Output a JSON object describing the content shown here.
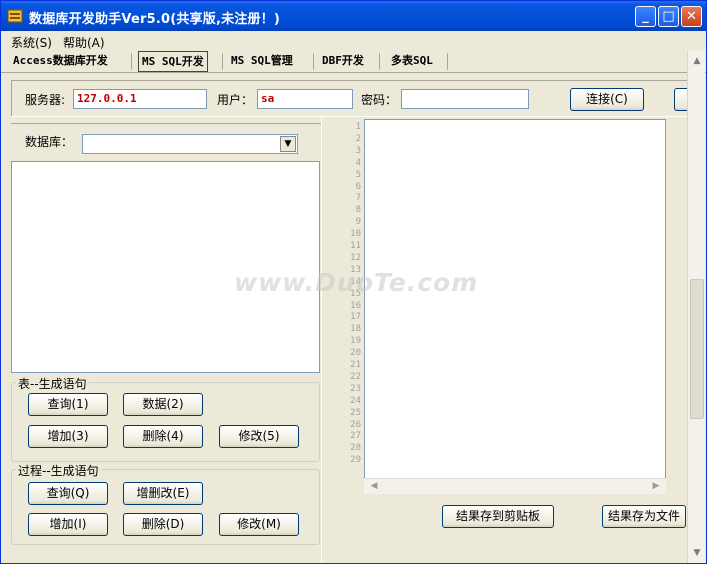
{
  "window": {
    "title": "数据库开发助手Ver5.0(共享版,未注册！)",
    "controls": {
      "minimize": "_",
      "maximize": "□",
      "close": "✕"
    }
  },
  "menu": [
    {
      "label": "系统(S)"
    },
    {
      "label": "帮助(A)"
    }
  ],
  "tabs": [
    {
      "label": "Access数据库开发",
      "active": false
    },
    {
      "label": "MS SQL开发",
      "active": true
    },
    {
      "label": "MS SQL管理",
      "active": false
    },
    {
      "label": "DBF开发",
      "active": false
    },
    {
      "label": "多表SQL",
      "active": false
    }
  ],
  "connection": {
    "server_label": "服务器:",
    "server_value": "127.0.0.1",
    "user_label": "用户：",
    "user_value": "sa",
    "password_label": "密码：",
    "password_value": "",
    "connect_button": "连接(C)"
  },
  "database": {
    "label": "数据库：",
    "selected": "",
    "arrow_icon": "▼"
  },
  "table_group": {
    "title": "表--生成语句",
    "buttons": {
      "query": "查询(1)",
      "data": "数据(2)",
      "add": "增加(3)",
      "delete": "删除(4)",
      "modify": "修改(5)"
    }
  },
  "proc_group": {
    "title": "过程--生成语句",
    "buttons": {
      "query": "查询(Q)",
      "add_del_mod": "增删改(E)",
      "add": "增加(I)",
      "delete": "删除(D)",
      "modify": "修改(M)"
    }
  },
  "editor": {
    "line_numbers": [
      "1",
      "2",
      "3",
      "4",
      "5",
      "6",
      "7",
      "8",
      "9",
      "10",
      "11",
      "12",
      "13",
      "14",
      "15",
      "16",
      "17",
      "18",
      "19",
      "20",
      "21",
      "22",
      "23",
      "24",
      "25",
      "26",
      "27",
      "28",
      "29"
    ],
    "content": ""
  },
  "results": {
    "copy_button": "结果存到剪贴板",
    "save_button": "结果存为文件"
  },
  "scroll_icons": {
    "left": "◀",
    "right": "▶",
    "up": "▲",
    "down": "▼"
  },
  "watermark": "www.DuoTe.com"
}
